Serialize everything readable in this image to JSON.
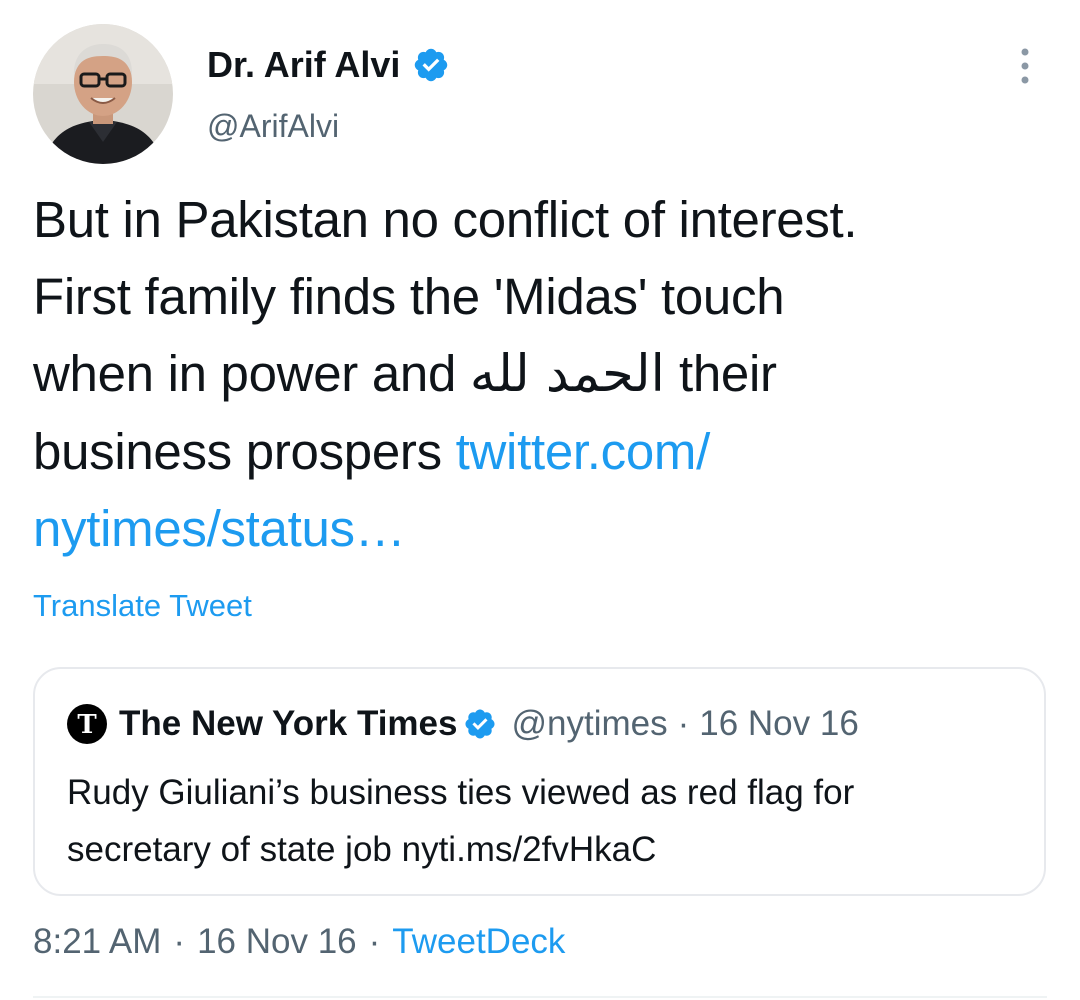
{
  "author": {
    "display_name": "Dr. Arif Alvi",
    "handle": "@ArifAlvi",
    "verified": true
  },
  "menu": {
    "icon": "more-vertical-icon"
  },
  "tweet": {
    "line1": "But in Pakistan no conflict of interest.",
    "line2": "First family finds the 'Midas' touch",
    "line3_start": "when in power and ",
    "line3_arabic": "الحمد لله",
    "line3_end": " their",
    "line4_start": "business prospers ",
    "link_part1": "twitter.com/",
    "link_part2": "nytimes/status…"
  },
  "translate_label": "Translate Tweet",
  "quoted_tweet": {
    "author_name": "The New York Times",
    "handle": "@nytimes",
    "separator": "·",
    "date": "16 Nov 16",
    "verified": true,
    "text_line1": "Rudy Giuliani’s business ties viewed as red flag for",
    "text_line2": "secretary of state job nyti.ms/2fvHkaC"
  },
  "meta": {
    "time": "8:21 AM",
    "separator": "·",
    "date": "16 Nov 16",
    "source": "TweetDeck"
  },
  "colors": {
    "accent": "#1d9bf0",
    "text": "#0f1419",
    "secondary": "#536471",
    "border": "#e7e9ed"
  }
}
